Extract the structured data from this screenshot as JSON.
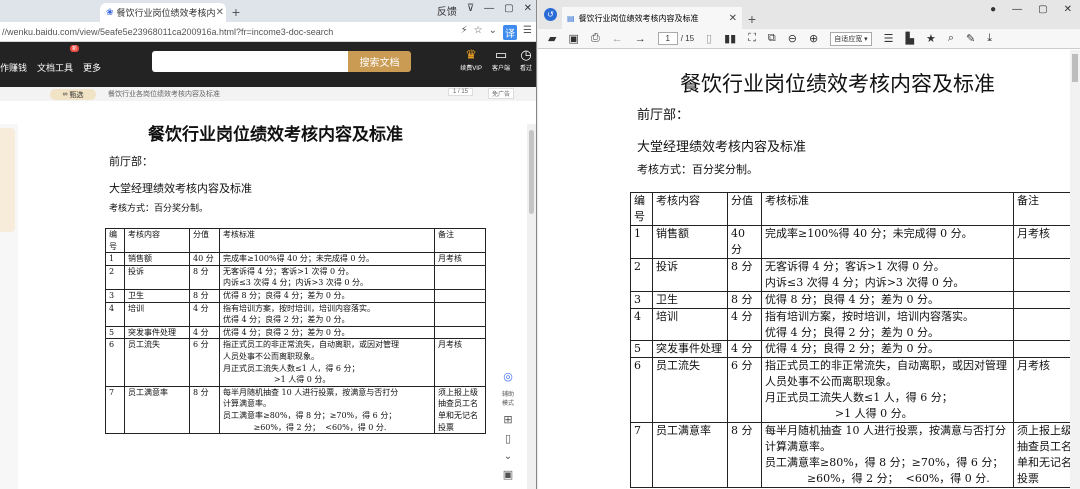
{
  "browser": {
    "tab_title": "餐饮行业岗位绩效考核内",
    "url": "//wenku.baidu.com/view/5eafe5e23968011ca200916a.html?fr=income3-doc-search",
    "window_controls": [
      "反馈",
      "⊽",
      "—",
      "▢",
      "✕"
    ],
    "url_icons": [
      "⚡",
      "☆",
      "⌄",
      "译",
      "☰"
    ]
  },
  "site": {
    "nav": [
      "作赚钱",
      "文档工具",
      "更多"
    ],
    "nav_badge": "新",
    "search_button": "搜索文档",
    "right_icons": [
      {
        "icon": "vip-icon",
        "label": "续费VIP"
      },
      {
        "icon": "client-icon",
        "label": "客户端"
      },
      {
        "icon": "clock-icon",
        "label": "看过"
      }
    ]
  },
  "docbar": {
    "pill": "甄选",
    "breadcrumb": "餐饮行业各岗位绩效考核内容及标准",
    "page": "1 / 15",
    "ad": "免广告"
  },
  "floatbar": [
    "辅助模式"
  ],
  "pdf": {
    "tab_title": "餐饮行业岗位绩效考核内容及标准",
    "page_current": "1",
    "page_total": "/ 15",
    "zoom": "自适应宽 ▾"
  },
  "document": {
    "title": "餐饮行业岗位绩效考核内容及标准",
    "section": "前厅部：",
    "subtitle": "大堂经理绩效考核内容及标准",
    "method": "考核方式：百分奖分制。",
    "headers": [
      "编号",
      "考核内容",
      "分值",
      "考核标准",
      "备注"
    ],
    "rows": [
      {
        "no": "1",
        "item": "销售额",
        "score": "40 分",
        "criteria": [
          "完成率≥100%得 40 分；未完成得 0 分。"
        ],
        "note": "月考核"
      },
      {
        "no": "2",
        "item": "投诉",
        "score": "8 分",
        "criteria": [
          "无客诉得 4 分；客诉>1 次得 0 分。",
          "内诉≤3 次得 4 分；内诉>3 次得 0 分。"
        ],
        "note": ""
      },
      {
        "no": "3",
        "item": "卫生",
        "score": "8 分",
        "criteria": [
          "优得 8 分；良得 4 分；差为 0 分。"
        ],
        "note": ""
      },
      {
        "no": "4",
        "item": "培训",
        "score": "4 分",
        "criteria": [
          "指有培训方案，按时培训，培训内容落实。",
          "优得 4 分；良得 2 分；差为 0 分。"
        ],
        "note": ""
      },
      {
        "no": "5",
        "item": "突发事件处理",
        "score": "4 分",
        "criteria": [
          "优得 4 分；良得 2 分；差为 0 分。"
        ],
        "note": ""
      },
      {
        "no": "6",
        "item": "员工流失",
        "score": "6 分",
        "criteria": [
          "指正式员工的非正常流失，自动离职，或因对管理",
          "人员处事不公而离职现象。",
          "月正式员工流失人数≤1 人，得 6 分；",
          "                    >1 人得 0 分。"
        ],
        "note": "月考核"
      },
      {
        "no": "7",
        "item": "员工满意率",
        "score": "8 分",
        "criteria": [
          "每半月随机抽查 10 人进行投票，按满意与否打分",
          "计算满意率。",
          "员工满意率≥80%，得 8 分；≥70%，得 6 分；",
          "            ≥60%，得 2 分；  <60%，得 0 分."
        ],
        "note": "须上报上级抽查员工名单和无记名投票"
      }
    ]
  }
}
